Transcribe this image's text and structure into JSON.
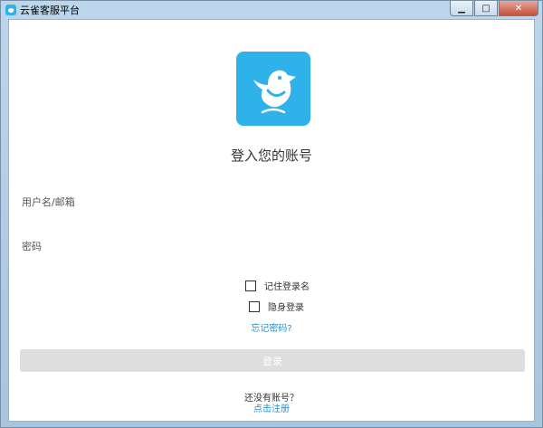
{
  "window": {
    "title": "云雀客服平台",
    "controls": {
      "minimize": "▁",
      "maximize": "□",
      "close": "✕"
    }
  },
  "login": {
    "heading": "登入您的账号",
    "username_placeholder": "用户名/邮箱",
    "password_placeholder": "密码",
    "remember_label": "记住登录名",
    "stealth_label": "隐身登录",
    "forgot_label": "忘记密码?",
    "submit_label": "登录",
    "no_account_label": "还没有账号？",
    "register_label": "点击注册"
  },
  "colors": {
    "brand": "#2fb1ea",
    "link": "#2a8fd0",
    "button_disabled": "#dedede"
  },
  "icons": {
    "app": "bird-icon",
    "logo": "bird-logo-icon"
  }
}
